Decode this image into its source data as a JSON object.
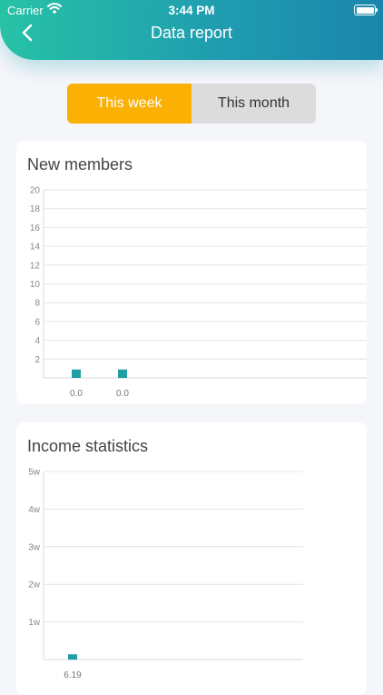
{
  "status": {
    "carrier": "Carrier",
    "time": "3:44 PM"
  },
  "nav": {
    "title": "Data report"
  },
  "tabs": [
    {
      "label": "This week",
      "active": true
    },
    {
      "label": "This month",
      "active": false
    }
  ],
  "colors": {
    "header": "#1f9bb0",
    "accent": "#fbb004",
    "bar": "#1f9ea6"
  },
  "chart_data": [
    {
      "type": "bar",
      "title": "New members",
      "ylim": [
        0,
        20
      ],
      "yticks": [
        "2",
        "4",
        "6",
        "8",
        "10",
        "12",
        "14",
        "16",
        "18",
        "20"
      ],
      "categories": [
        "0.0",
        "0.0"
      ],
      "values": [
        0.9,
        0.9
      ],
      "grid": true
    },
    {
      "type": "bar",
      "title": "Income statistics",
      "ylim": [
        0,
        5
      ],
      "yticks": [
        "1w",
        "2w",
        "3w",
        "4w",
        "5w"
      ],
      "categories": [
        "6.19"
      ],
      "values": [
        0.14
      ],
      "grid": true
    }
  ]
}
